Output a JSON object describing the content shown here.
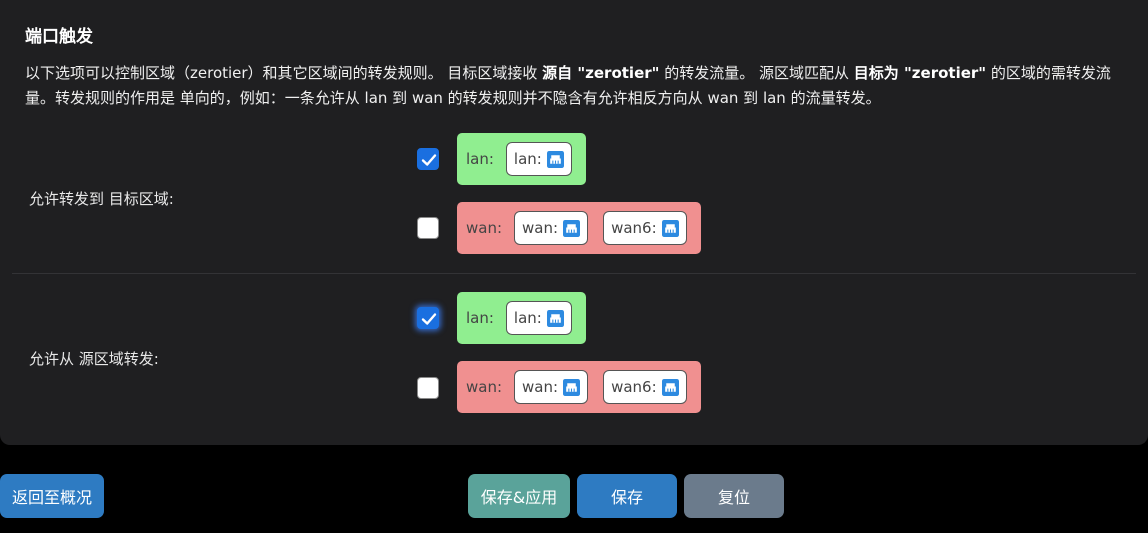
{
  "section": {
    "title": "端口触发",
    "description_line1_a": "以下选项可以控制区域（zerotier）和其它区域间的转发规则。  目标区域接收 ",
    "description_bold_1": "源自 \"zerotier\"",
    "description_line1_b": " 的转发流量。  源区域匹配从 ",
    "description_bold_2": "目标为 \"zerotier\"",
    "description_line1_c": " 的区域的需转发流量。转发规则的作用是  单向的，例如：一条允许从 lan 到 wan 的转发规则并不隐含有允许相反方向从 wan 到 lan 的流量转发。"
  },
  "forward_to": {
    "label": "允许转发到  目标区域:",
    "zones": [
      {
        "name": "lan:",
        "checked": true,
        "color": "#90ee90",
        "networks": [
          {
            "name": "lan:",
            "icon": "network-port-icon"
          }
        ]
      },
      {
        "name": "wan:",
        "checked": false,
        "color": "#f09090",
        "networks": [
          {
            "name": "wan:",
            "icon": "network-port-icon"
          },
          {
            "name": "wan6:",
            "icon": "network-port-icon"
          }
        ]
      }
    ]
  },
  "forward_from": {
    "label": "允许从  源区域转发:",
    "zones": [
      {
        "name": "lan:",
        "checked": true,
        "color": "#90ee90",
        "networks": [
          {
            "name": "lan:",
            "icon": "network-port-icon"
          }
        ]
      },
      {
        "name": "wan:",
        "checked": false,
        "color": "#f09090",
        "networks": [
          {
            "name": "wan:",
            "icon": "network-port-icon"
          },
          {
            "name": "wan6:",
            "icon": "network-port-icon"
          }
        ]
      }
    ]
  },
  "footer": {
    "back_label": "返回至概况",
    "save_apply_label": "保存&应用",
    "save_label": "保存",
    "reset_label": "复位"
  },
  "colors": {
    "accent": "#1a6fe0",
    "back_button": "#2e7bc2",
    "save_apply_button": "#5aa39a",
    "save_button": "#2e7bc2",
    "reset_button": "#6b7b8c"
  }
}
